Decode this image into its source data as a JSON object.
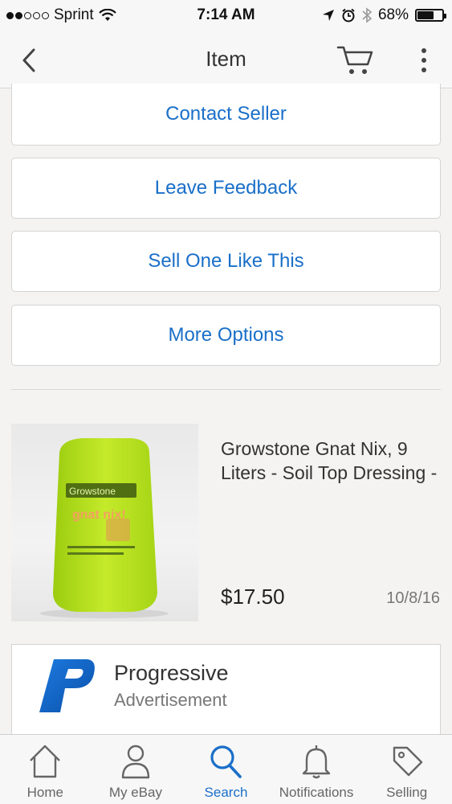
{
  "status_bar": {
    "carrier": "Sprint",
    "time": "7:14 AM",
    "battery_percent": "68%",
    "battery_level": 0.68,
    "signal_bars_filled": 2,
    "icons": [
      "wifi-icon",
      "location-arrow-icon",
      "alarm-icon",
      "bluetooth-icon",
      "battery-icon"
    ]
  },
  "nav": {
    "title": "Item",
    "icons": [
      "chevron-left-icon",
      "cart-icon",
      "more-vertical-icon"
    ]
  },
  "actions": [
    {
      "label": "Contact Seller"
    },
    {
      "label": "Leave Feedback"
    },
    {
      "label": "Sell One Like This"
    },
    {
      "label": "More Options"
    }
  ],
  "item": {
    "title": "Growstone Gnat Nix, 9 Liters - Soil Top Dressing -",
    "price": "$17.50",
    "date": "10/8/16",
    "image_text": {
      "brand": "Growstone",
      "product": "gnat nix!"
    }
  },
  "ad": {
    "title": "Progressive",
    "subtitle": "Advertisement",
    "logo_letter": "P"
  },
  "tabs": [
    {
      "label": "Home",
      "icon": "home-icon"
    },
    {
      "label": "My eBay",
      "icon": "person-icon"
    },
    {
      "label": "Search",
      "icon": "search-icon",
      "active": true
    },
    {
      "label": "Notifications",
      "icon": "bell-icon"
    },
    {
      "label": "Selling",
      "icon": "tag-icon"
    }
  ],
  "colors": {
    "link_blue": "#1a6fc9",
    "background": "#f4f3f1",
    "bag_green": "#b8e01e"
  }
}
